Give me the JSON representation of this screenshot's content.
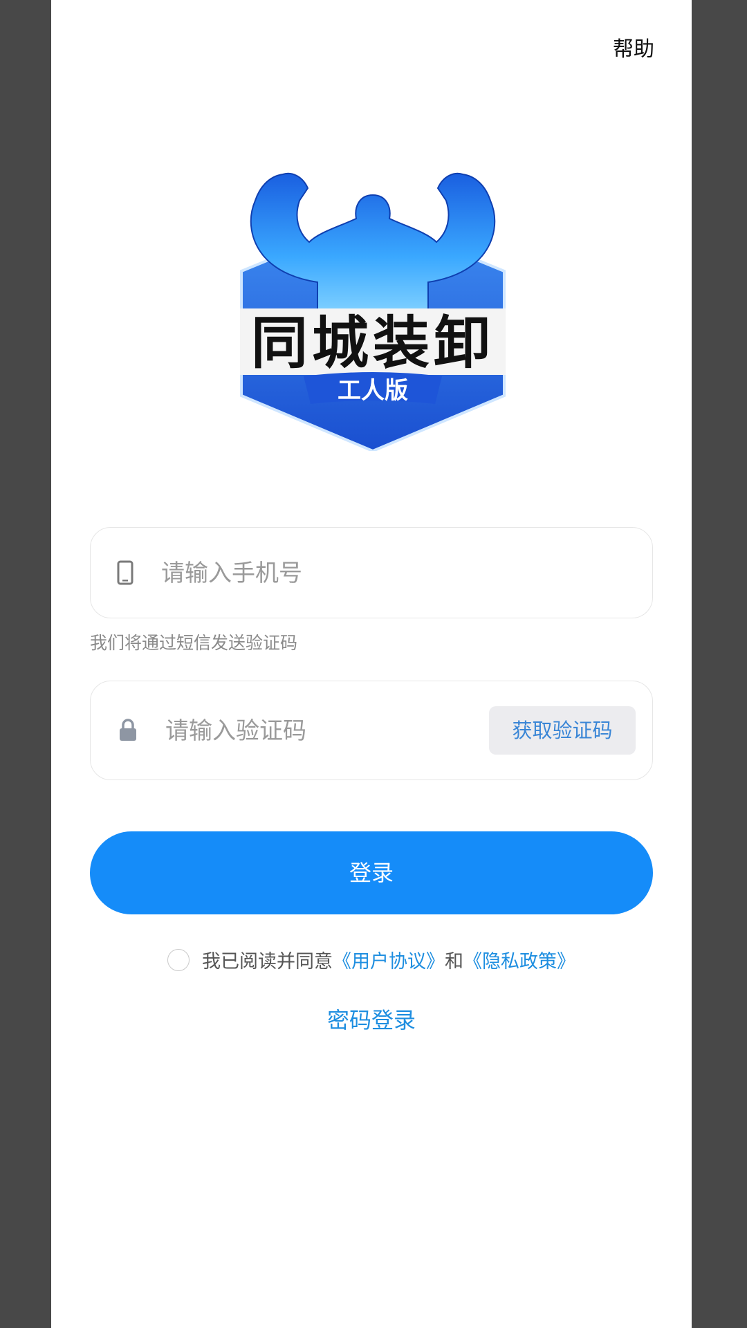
{
  "header": {
    "help_label": "帮助"
  },
  "logo": {
    "title": "同城装卸",
    "subtitle": "工人版",
    "colors": {
      "primary": "#1f6fe0",
      "light": "#4fb0ff"
    }
  },
  "phone_input": {
    "placeholder": "请输入手机号",
    "icon": "phone-icon"
  },
  "phone_hint": "我们将通过短信发送验证码",
  "code_input": {
    "placeholder": "请输入验证码",
    "icon": "lock-icon"
  },
  "get_code_label": "获取验证码",
  "login_label": "登录",
  "agreement": {
    "prefix": "我已阅读并同意",
    "user_agreement": "《用户协议》",
    "and": "和",
    "privacy_policy": "《隐私政策》"
  },
  "password_login_label": "密码登录",
  "colors": {
    "accent": "#158cf9",
    "link": "#1e8ee0"
  }
}
